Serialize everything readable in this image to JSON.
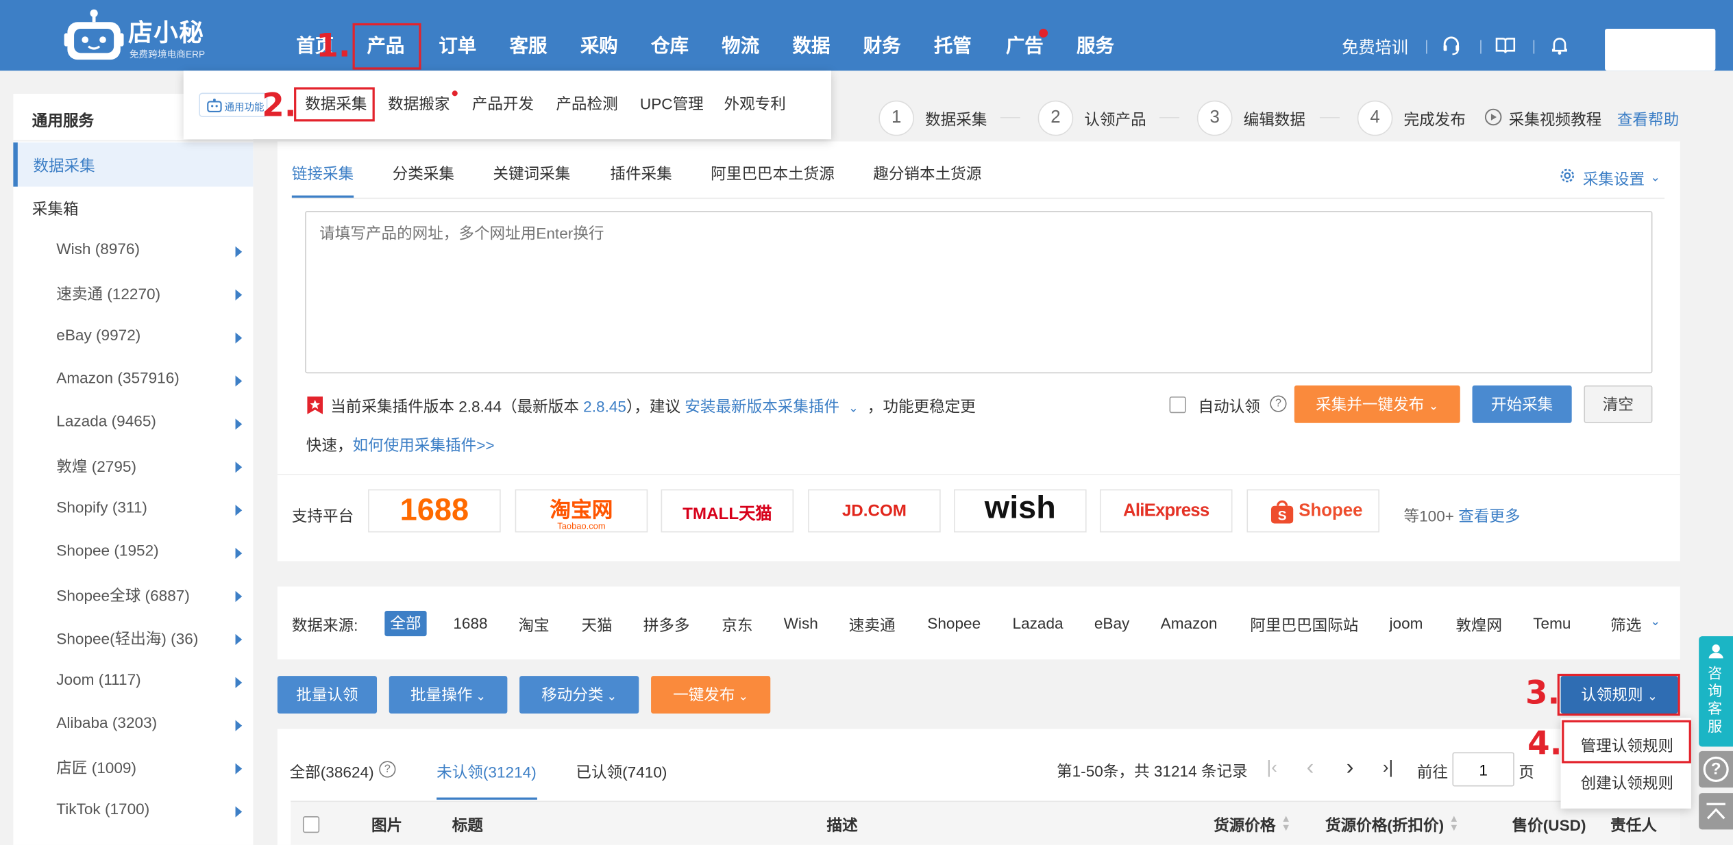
{
  "brand": {
    "name": "店小秘",
    "subtitle": "免费跨境电商ERP"
  },
  "nav": {
    "items": [
      "首页",
      "产品",
      "订单",
      "客服",
      "采购",
      "仓库",
      "物流",
      "数据",
      "财务",
      "托管",
      "广告",
      "服务"
    ],
    "training": "免费培训"
  },
  "annotations": [
    "1.",
    "2.",
    "3.",
    "4."
  ],
  "dropdown": {
    "tag": "通用功能",
    "items": [
      "数据采集",
      "数据搬家",
      "产品开发",
      "产品检测",
      "UPC管理",
      "外观专利"
    ]
  },
  "sidebar": {
    "header": "通用服务",
    "active": "数据采集",
    "group": "采集箱",
    "items": [
      "Wish (8976)",
      "速卖通 (12270)",
      "eBay (9972)",
      "Amazon (357916)",
      "Lazada (9465)",
      "敦煌 (2795)",
      "Shopify (311)",
      "Shopee (1952)",
      "Shopee全球 (6887)",
      "Shopee(轻出海) (36)",
      "Joom (1117)",
      "Alibaba (3203)",
      "店匠 (1009)",
      "TikTok (1700)"
    ]
  },
  "steps": {
    "items": [
      {
        "num": "1",
        "label": "数据采集"
      },
      {
        "num": "2",
        "label": "认领产品"
      },
      {
        "num": "3",
        "label": "编辑数据"
      },
      {
        "num": "4",
        "label": "完成发布"
      }
    ],
    "video": "采集视频教程",
    "help": "查看帮助"
  },
  "collect": {
    "tabs": [
      "链接采集",
      "分类采集",
      "关键词采集",
      "插件采集",
      "阿里巴巴本土货源",
      "趣分销本土货源"
    ],
    "settings": "采集设置",
    "placeholder": "请填写产品的网址，多个网址用Enter换行",
    "plugin": {
      "pre": "当前采集插件版本 2.8.44（最新版本 ",
      "latest": "2.8.45",
      "mid": "），建议 ",
      "install": "安装最新版本采集插件",
      "post": "，功能更稳定更",
      "line2": "快速，",
      "howto": "如何使用采集插件>>"
    },
    "auto_claim": "自动认领",
    "buttons": {
      "collect_publish": "采集并一键发布",
      "start": "开始采集",
      "clear": "清空"
    },
    "platforms_label": "支持平台",
    "platforms": [
      "1688",
      "淘宝网",
      "Taobao.com",
      "TMALL天猫",
      "JD.COM",
      "wish",
      "AliExpress",
      "Shopee"
    ],
    "more_prefix": "等100+",
    "more": "查看更多"
  },
  "source": {
    "label": "数据来源:",
    "items": [
      "全部",
      "1688",
      "淘宝",
      "天猫",
      "拼多多",
      "京东",
      "Wish",
      "速卖通",
      "Shopee",
      "Lazada",
      "eBay",
      "Amazon",
      "阿里巴巴国际站",
      "joom",
      "敦煌网",
      "Temu"
    ],
    "filter": "筛选"
  },
  "actions": {
    "batch_claim": "批量认领",
    "batch_ops": "批量操作",
    "move": "移动分类",
    "publish": "一键发布",
    "claim_rules": "认领规则"
  },
  "rules_menu": [
    "管理认领规则",
    "创建认领规则"
  ],
  "list": {
    "tabs": [
      "全部(38624)",
      "未认领(31214)",
      "已认领(7410)"
    ],
    "summary": "第1-50条，共 31214 条记录",
    "goto": "前往",
    "page": "1",
    "page_unit": "页",
    "columns": [
      "图片",
      "标题",
      "描述",
      "货源价格",
      "货源价格(折扣价)",
      "售价(USD)",
      "责任人"
    ]
  },
  "float": {
    "service": "咨询客服"
  },
  "colors": {
    "primary": "#3d7fc6",
    "orange": "#fa8a3c",
    "annotation": "#e3232c",
    "background": "#f2f2f2"
  }
}
